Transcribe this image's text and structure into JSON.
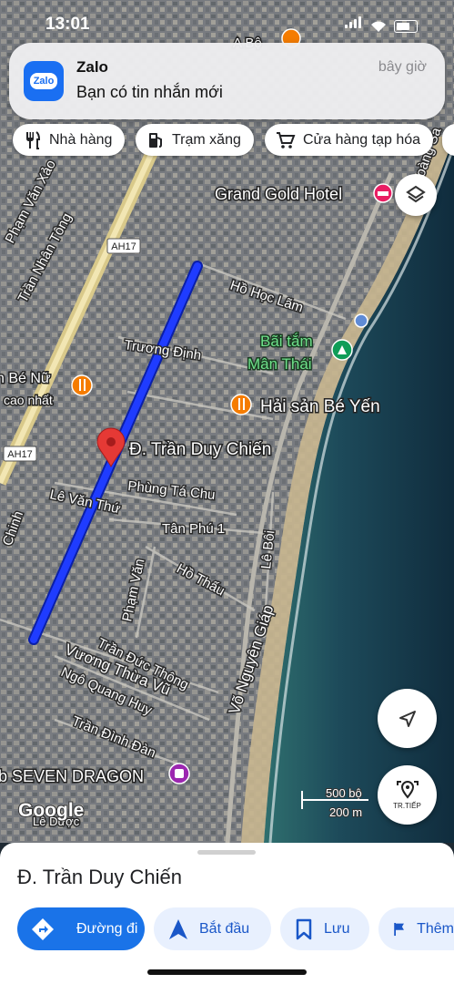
{
  "status_bar": {
    "time": "13:01"
  },
  "notification": {
    "app_name": "Zalo",
    "app_icon_text": "Zalo",
    "message": "Bạn có tin nhắn mới",
    "time": "bây giờ"
  },
  "chips": [
    {
      "label": "Nhà hàng",
      "icon": "restaurant-icon"
    },
    {
      "label": "Trạm xăng",
      "icon": "gas-station-icon"
    },
    {
      "label": "Cửa hàng tạp hóa",
      "icon": "cart-icon"
    }
  ],
  "map": {
    "streets": {
      "tran_nhan_tong": "Trần Nhân Tông",
      "pham_van_xao": "Phạm Văn Xảo",
      "ah17_top": "AH17",
      "ah17_left": "AH17",
      "ho_hoc_lam": "Hồ Học Lãm",
      "truong_dinh": "Trương Định",
      "phung_ta_chu": "Phùng Tá Chu",
      "le_van_thu": "Lê Văn Thứ",
      "tan_phu_1": "Tân Phú 1",
      "ho_thau": "Hồ Thấu",
      "le_boi": "Lê Bôi",
      "pham_van": "Phạm Văn",
      "tran_duc_thong": "Trần Đức Thông",
      "vuong_thua_vu": "Vương Thừa Vũ",
      "ngo_quang_huy": "Ngô Quang Huy",
      "vo_nguyen_giap": "Võ Nguyên Giáp",
      "tran_dinh_dan": "Trần Đình Đàn",
      "hoang_sa": "Hoàng Sa",
      "le_duoc": "Lê Dược",
      "chinh": "Chinh"
    },
    "places": {
      "grand_gold": "Grand Gold Hotel",
      "bai_tam_line1": "Bãi tắm",
      "bai_tam_line2": "Mân Thái",
      "hai_san": "Hải sản Bé Yến",
      "be_nu": "n Bé Nữ",
      "cao_nhat": "cao nhất",
      "seven_dragon": "b SEVEN DRAGON",
      "a_bo": "A Bộ"
    },
    "selected_label": "Đ. Trần Duy Chiến",
    "google_logo": "Google",
    "scale": {
      "top": "500 bộ",
      "bottom": "200 m"
    },
    "recenter_label": "TR.TIẾP"
  },
  "sheet": {
    "title": "Đ. Trần Duy Chiến",
    "buttons": [
      {
        "label": "Đường đi",
        "icon": "directions-icon"
      },
      {
        "label": "Bắt đầu",
        "icon": "navigation-arrow-icon"
      },
      {
        "label": "Lưu",
        "icon": "bookmark-icon"
      },
      {
        "label": "Thêm",
        "icon": "flag-icon"
      }
    ]
  },
  "colors": {
    "route": "#1f3cff",
    "pin": "#e53935",
    "primary": "#1a73e8",
    "poi_orange": "#f57c00",
    "poi_purple": "#9c27b0",
    "poi_pink": "#e91e63",
    "poi_green": "#0f9d58"
  }
}
